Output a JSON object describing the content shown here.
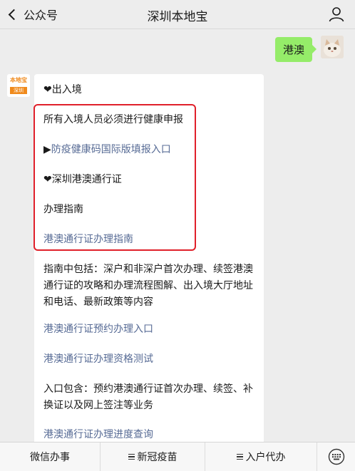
{
  "header": {
    "back_label": "公众号",
    "title": "深圳本地宝"
  },
  "user_message": {
    "text": "港澳"
  },
  "bot_message": {
    "avatar_text_top": "本地宝",
    "avatar_text_bottom": "深圳",
    "line1": "❤出入境",
    "line2": "所有入境人员必须进行健康申报",
    "line3_prefix": "▶",
    "line3_link": "防疫健康码国际版填报入口",
    "line4": "❤深圳港澳通行证",
    "line5": "办理指南",
    "line6_link": "港澳通行证办理指南",
    "para1": "指南中包括：深户和非深户首次办理、续签港澳通行证的攻略和办理流程图解、出入境大厅地址和电话、最新政策等内容",
    "link_booking": "港澳通行证预约办理入口",
    "link_test": "港澳通行证办理资格测试",
    "para2": "入口包含：预约港澳通行证首次办理、续签、补换证以及网上签注等业务",
    "link_progress": "港澳通行证办理进度查询"
  },
  "menu": {
    "item1": "微信办事",
    "item2": "新冠疫苗",
    "item3": "入户代办"
  },
  "colors": {
    "link": "#576b95",
    "user_bubble": "#95ec69",
    "highlight": "#e0202a"
  }
}
